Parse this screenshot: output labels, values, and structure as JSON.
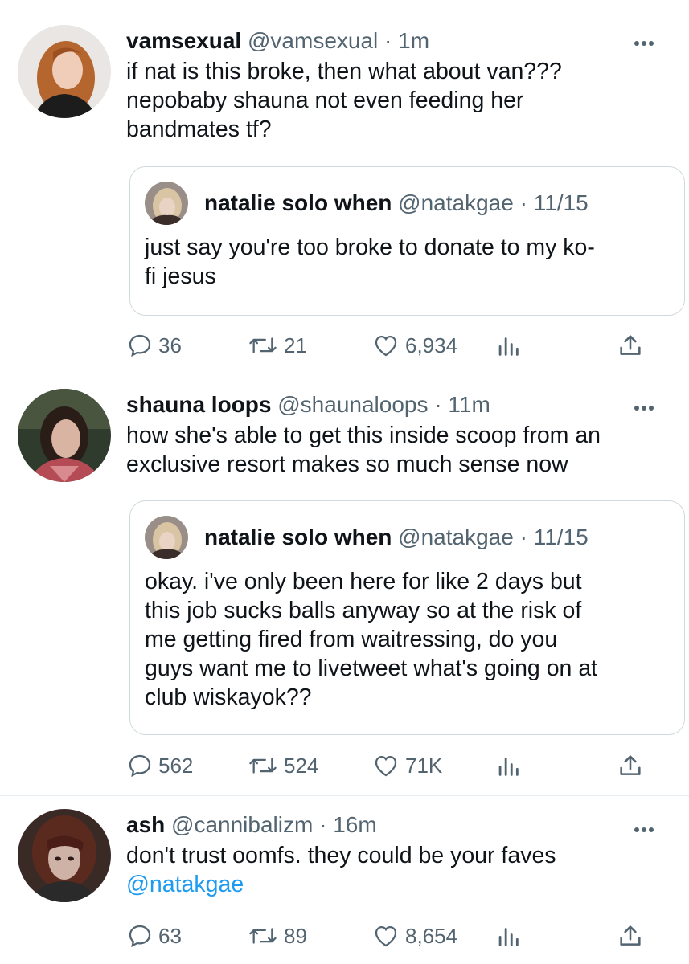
{
  "icons": {
    "more": "more-horizontal-icon",
    "reply": "reply-bubble-icon",
    "retweet": "retweet-icon",
    "like": "heart-icon",
    "analytics": "bar-chart-icon",
    "share": "share-upload-icon"
  },
  "colors": {
    "link": "#1d9bf0",
    "secondary": "#536471",
    "border": "#cfd9de"
  },
  "tweets": [
    {
      "name": "vamsexual",
      "handle": "@vamsexual",
      "dot": "·",
      "time": "1m",
      "text_lines": [
        "if nat is this broke, then what about van???",
        "nepobaby shauna not even feeding her",
        "bandmates tf?"
      ],
      "quote": {
        "name": "natalie solo when",
        "handle": "@natakgae",
        "dot": "·",
        "time": "11/15",
        "text_lines": [
          "just say you're too broke to donate to my ko-",
          "fi jesus"
        ]
      },
      "replies": "36",
      "retweets": "21",
      "likes": "6,934"
    },
    {
      "name": "shauna loops",
      "handle": "@shaunaloops",
      "dot": "·",
      "time": "11m",
      "text_lines": [
        "how she's able to get this inside scoop from an",
        "exclusive resort makes so much sense now"
      ],
      "quote": {
        "name": "natalie solo when",
        "handle": "@natakgae",
        "dot": "·",
        "time": "11/15",
        "text_lines": [
          "okay. i've only been here for like 2 days but",
          "this job sucks balls anyway so at the risk of",
          "me getting fired from waitressing, do you",
          "guys want me to livetweet what's going on at",
          "club wiskayok??"
        ]
      },
      "replies": "562",
      "retweets": "524",
      "likes": "71K"
    },
    {
      "name": "ash",
      "handle": "@cannibalizm",
      "dot": "·",
      "time": "16m",
      "text_lines": [
        "don't trust oomfs. they could be your faves"
      ],
      "mention": "@natakgae",
      "replies": "63",
      "retweets": "89",
      "likes": "8,654"
    }
  ]
}
